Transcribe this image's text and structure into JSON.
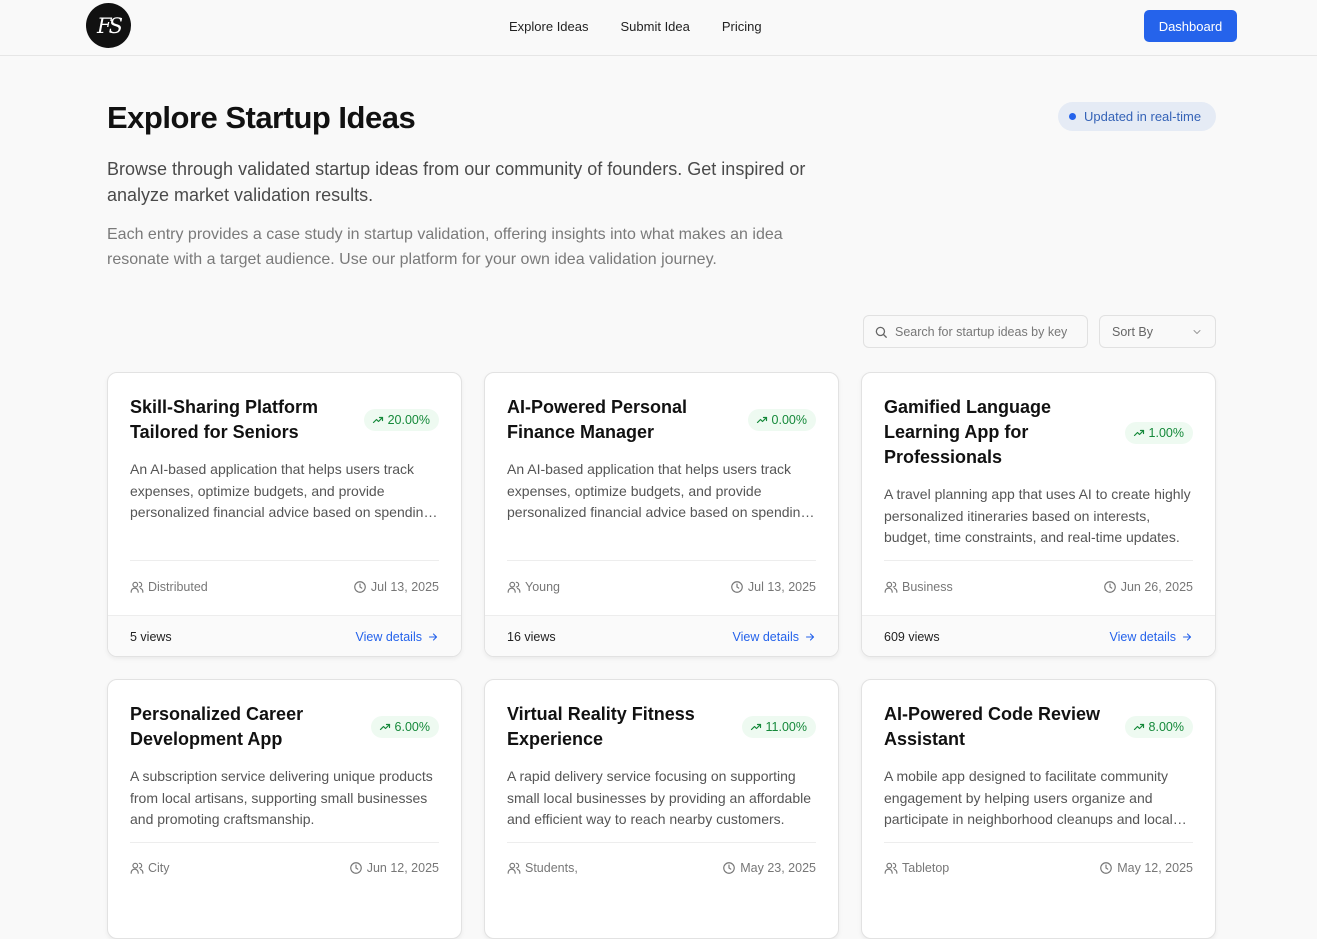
{
  "brand": {
    "logo_text": "FS"
  },
  "nav": {
    "items": [
      {
        "label": "Explore Ideas"
      },
      {
        "label": "Submit Idea"
      },
      {
        "label": "Pricing"
      }
    ],
    "dashboard_label": "Dashboard"
  },
  "hero": {
    "title": "Explore Startup Ideas",
    "realtime_label": "Updated in real-time",
    "lead": "Browse through validated startup ideas from our community of founders. Get inspired or analyze market validation results.",
    "sub": "Each entry provides a case study in startup validation, offering insights into what makes an idea resonate with a target audience. Use our platform for your own idea validation journey."
  },
  "controls": {
    "search_placeholder": "Search for startup ideas by keyword",
    "sort_label": "Sort By"
  },
  "colors": {
    "accent": "#2563eb",
    "badge_green": "#15893a",
    "badge_bg": "#eefaf1"
  },
  "cards": [
    {
      "title": "Skill-Sharing Platform Tailored for Seniors",
      "growth": "20.00%",
      "description": "An AI-based application that helps users track expenses, optimize budgets, and provide personalized financial advice based on spending habits and goals.",
      "audience": "Distributed",
      "date": "Jul 13, 2025",
      "views": "5 views",
      "link": "View details"
    },
    {
      "title": "AI-Powered Personal Finance Manager",
      "growth": "0.00%",
      "description": "An AI-based application that helps users track expenses, optimize budgets, and provide personalized financial advice based on spending habits and goals.",
      "audience": "Young",
      "date": "Jul 13, 2025",
      "views": "16 views",
      "link": "View details"
    },
    {
      "title": "Gamified Language Learning App for Professionals",
      "growth": "1.00%",
      "description": "A travel planning app that uses AI to create highly personalized itineraries based on interests, budget, time constraints, and real-time updates.",
      "audience": "Business",
      "date": "Jun 26, 2025",
      "views": "609 views",
      "link": "View details"
    },
    {
      "title": "Personalized Career Development App",
      "growth": "6.00%",
      "description": "A subscription service delivering unique products from local artisans, supporting small businesses and promoting craftsmanship.",
      "audience": "City",
      "date": "Jun 12, 2025",
      "views": "",
      "link": ""
    },
    {
      "title": "Virtual Reality Fitness Experience",
      "growth": "11.00%",
      "description": "A rapid delivery service focusing on supporting small local businesses by providing an affordable and efficient way to reach nearby customers.",
      "audience": "Students,",
      "date": "May 23, 2025",
      "views": "",
      "link": ""
    },
    {
      "title": "AI-Powered Code Review Assistant",
      "growth": "8.00%",
      "description": "A mobile app designed to facilitate community engagement by helping users organize and participate in neighborhood cleanups and local events.",
      "audience": "Tabletop",
      "date": "May 12, 2025",
      "views": "",
      "link": ""
    }
  ]
}
